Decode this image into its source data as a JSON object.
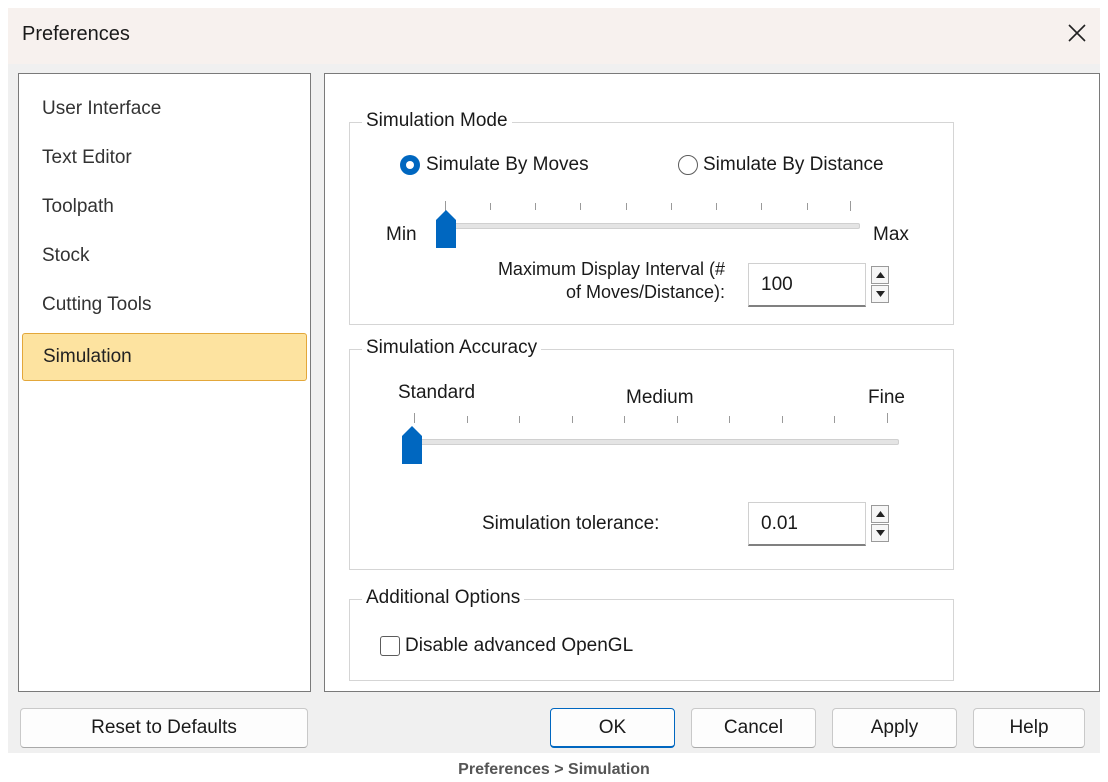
{
  "window": {
    "title": "Preferences"
  },
  "sidebar": {
    "items": [
      {
        "label": "User Interface"
      },
      {
        "label": "Text Editor"
      },
      {
        "label": "Toolpath"
      },
      {
        "label": "Stock"
      },
      {
        "label": "Cutting Tools"
      },
      {
        "label": "Simulation",
        "selected": true
      }
    ]
  },
  "simulation_mode": {
    "group_label": "Simulation Mode",
    "radio_moves": {
      "label": "Simulate By Moves",
      "checked": true
    },
    "radio_distance": {
      "label": "Simulate By Distance",
      "checked": false
    },
    "slider_min_label": "Min",
    "slider_max_label": "Max",
    "slider_value": 0,
    "interval_label_line1": "Maximum Display Interval (#",
    "interval_label_line2": "of Moves/Distance):",
    "interval_value": "100"
  },
  "simulation_accuracy": {
    "group_label": "Simulation Accuracy",
    "label_standard": "Standard",
    "label_medium": "Medium",
    "label_fine": "Fine",
    "slider_value": 0,
    "tolerance_label": "Simulation tolerance:",
    "tolerance_value": "0.01"
  },
  "additional_options": {
    "group_label": "Additional Options",
    "disable_opengl_label": "Disable advanced OpenGL",
    "disable_opengl_checked": false
  },
  "footer": {
    "reset_label": "Reset to Defaults",
    "ok_label": "OK",
    "cancel_label": "Cancel",
    "apply_label": "Apply",
    "help_label": "Help"
  },
  "caption": "Preferences > Simulation",
  "colors": {
    "accent": "#0067c0",
    "selection_bg": "#fde3a0",
    "selection_border": "#e3a73a"
  }
}
